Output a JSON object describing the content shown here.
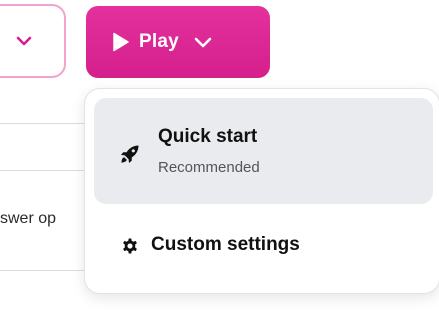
{
  "play_button": {
    "label": "Play",
    "color": "#da2490"
  },
  "left_button": {
    "border_color": "#f2a3cf"
  },
  "background": {
    "text_fragment": "swer op"
  },
  "dropdown": {
    "items": [
      {
        "title": "Quick start",
        "subtitle": "Recommended",
        "icon": "rocket-icon"
      },
      {
        "title": "Custom settings",
        "icon": "gear-icon"
      }
    ]
  }
}
